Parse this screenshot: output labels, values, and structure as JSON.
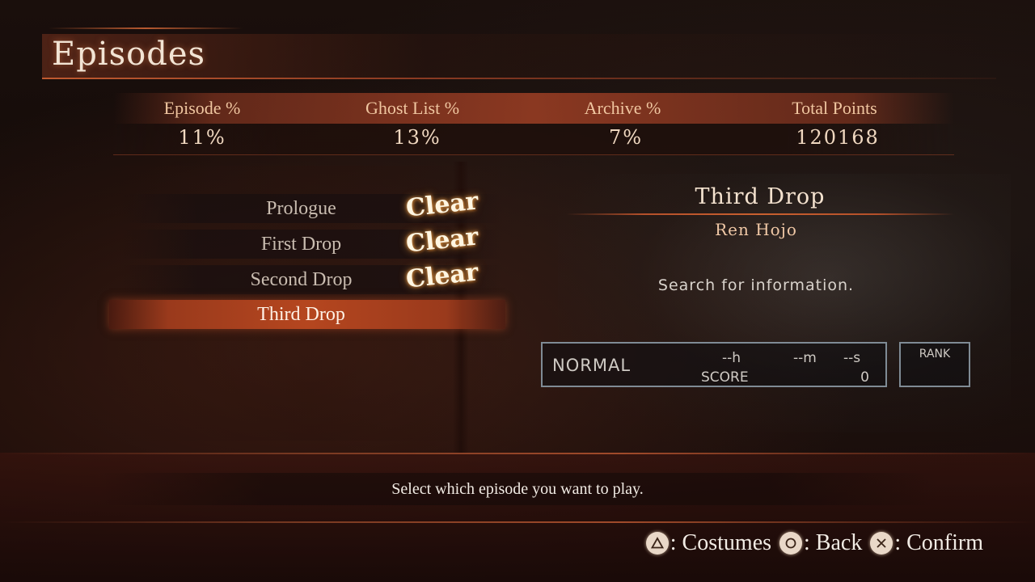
{
  "screen_title": "Episodes",
  "stats": [
    {
      "label": "Episode %",
      "value": "11%"
    },
    {
      "label": "Ghost List %",
      "value": "13%"
    },
    {
      "label": "Archive %",
      "value": "7%"
    },
    {
      "label": "Total Points",
      "value": "120168"
    }
  ],
  "episodes": [
    {
      "name": "Prologue",
      "status": "Clear"
    },
    {
      "name": "First Drop",
      "status": "Clear"
    },
    {
      "name": "Second Drop",
      "status": "Clear"
    },
    {
      "name": "Third Drop",
      "status": ""
    }
  ],
  "selected_episode_index": 3,
  "detail": {
    "title": "Third Drop",
    "character": "Ren Hojo",
    "objective": "Search for information.",
    "record": {
      "difficulty": "NORMAL",
      "hours": "--h",
      "minutes": "--m",
      "seconds": "--s",
      "score_label": "SCORE",
      "score": "0"
    },
    "rank_label": "RANK"
  },
  "help_text": "Select which episode you want to play.",
  "controls": [
    {
      "icon": "triangle-button-icon",
      "label": ": Costumes"
    },
    {
      "icon": "circle-button-icon",
      "label": ": Back"
    },
    {
      "icon": "cross-button-icon",
      "label": ": Confirm"
    }
  ],
  "colors": {
    "accent": "#b5461f",
    "stat_label": "#f0c6a0",
    "clear_glow": "#e8a050"
  }
}
